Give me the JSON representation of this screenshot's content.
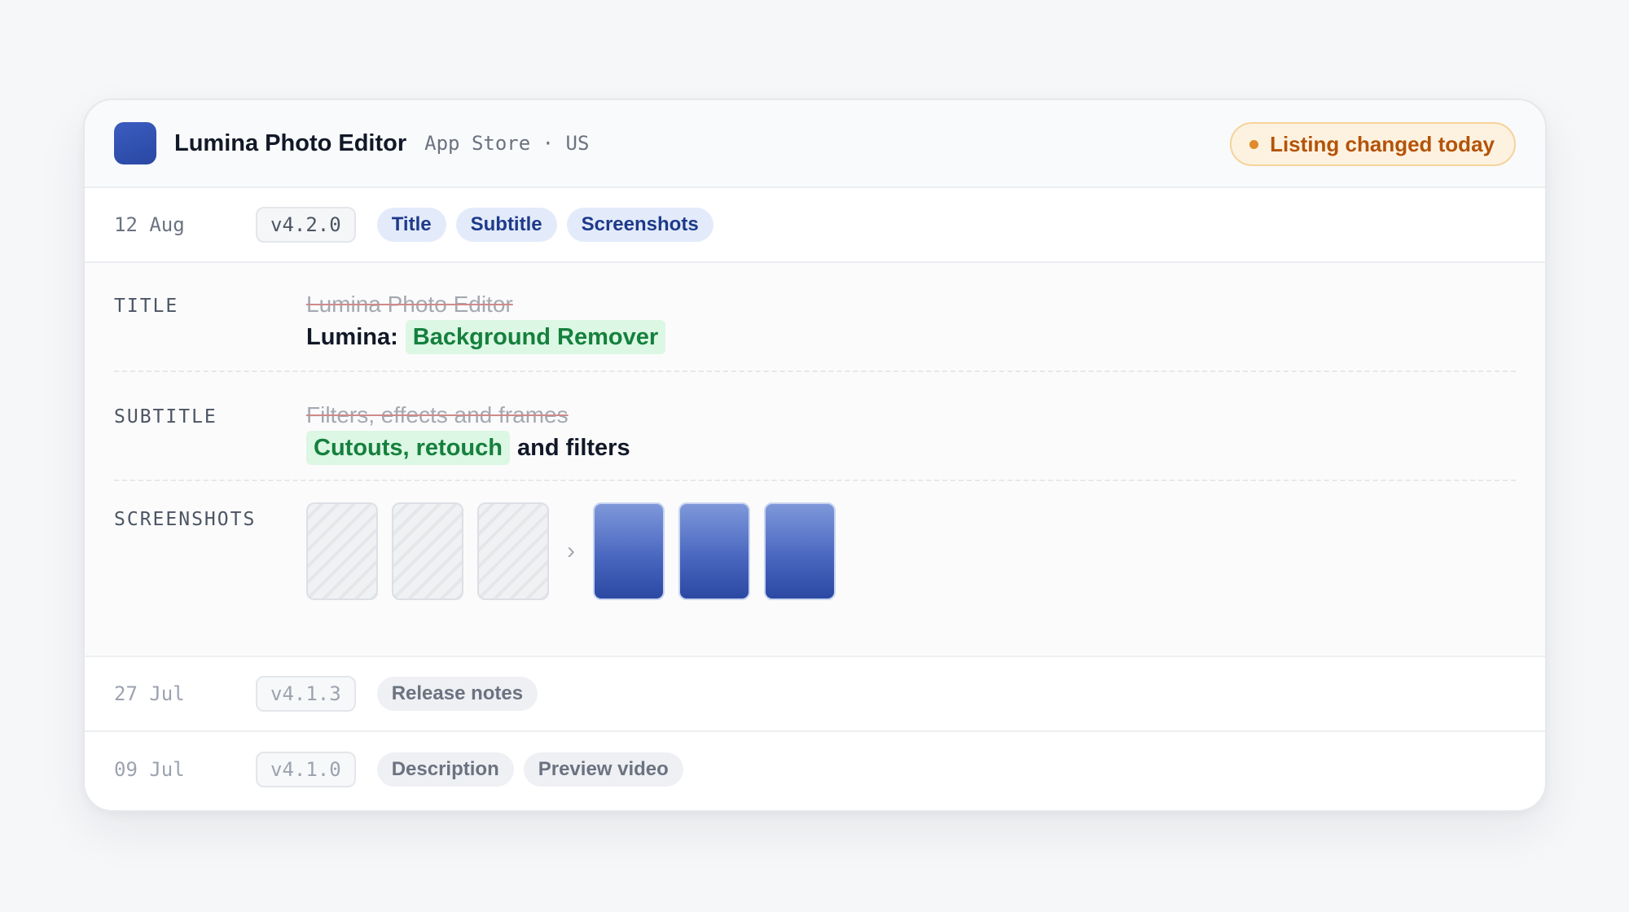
{
  "app": {
    "name": "Lumina Photo Editor",
    "meta": "App Store · US",
    "alert": "Listing changed today",
    "icon_color": "#2f4fae"
  },
  "entries": [
    {
      "date": "12 Aug",
      "version": "v4.2.0",
      "tags": [
        "Title",
        "Subtitle",
        "Screenshots"
      ]
    },
    {
      "date": "27 Jul",
      "version": "v4.1.3",
      "tags": [
        "Release notes"
      ]
    },
    {
      "date": "09 Jul",
      "version": "v4.1.0",
      "tags": [
        "Description",
        "Preview video"
      ]
    }
  ],
  "changes": {
    "title": {
      "label": "TITLE",
      "old": "Lumina Photo Editor",
      "new_prefix": "Lumina:",
      "new_inserted": "Background Remover"
    },
    "subtitle": {
      "label": "SUBTITLE",
      "old": "Filters, effects and frames",
      "new_inserted": "Cutouts, retouch",
      "new_suffix": "and filters"
    },
    "screenshots": {
      "label": "SCREENSHOTS",
      "arrow": "›",
      "old_count": 3,
      "new_count": 3
    }
  },
  "colors": {
    "accent": "#1e3a8a",
    "inserted_text": "#15803d",
    "inserted_bg": "#dcf7e4",
    "alert_text": "#b45309",
    "alert_bg": "#fdf2e0"
  }
}
